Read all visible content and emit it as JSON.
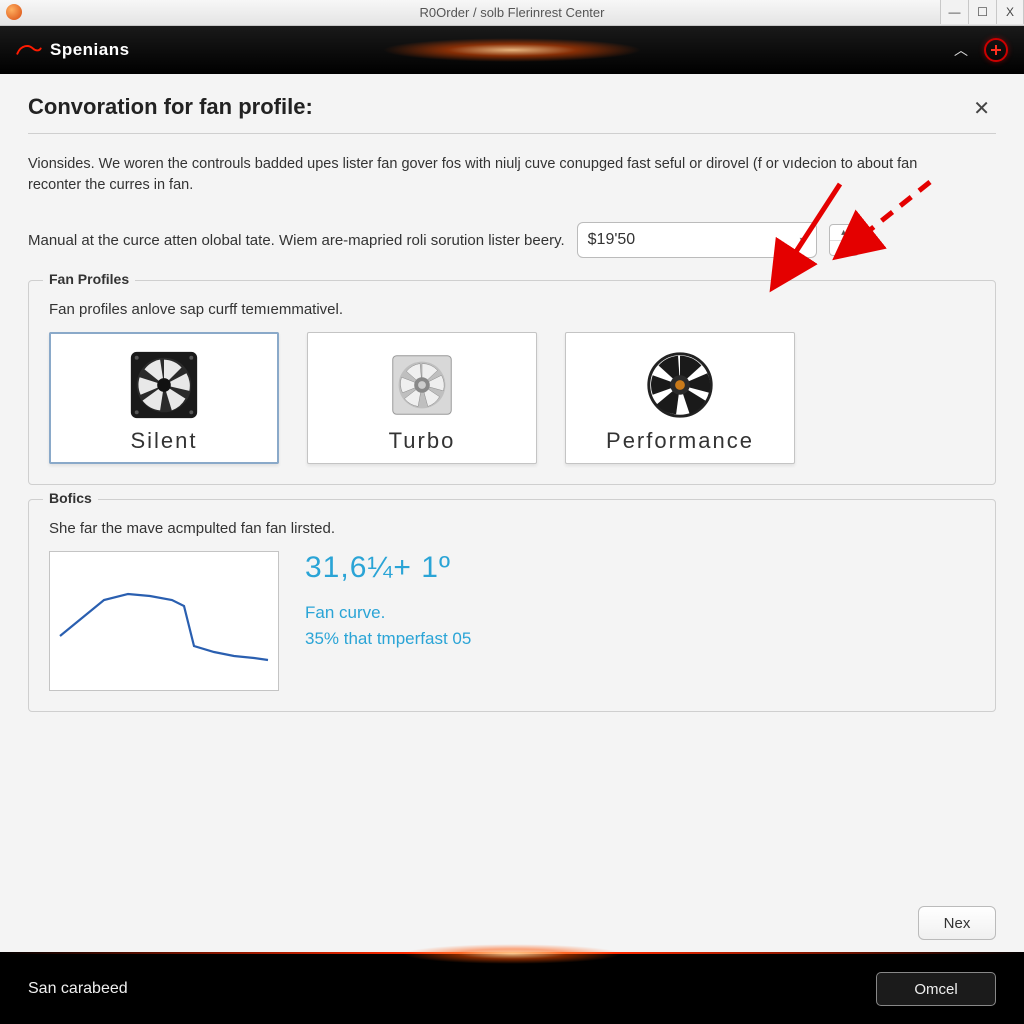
{
  "os": {
    "title": "R0Order / solb Flerinrest Center",
    "min": "—",
    "max": "☐",
    "close": "X"
  },
  "brand": {
    "name": "Spenians"
  },
  "page": {
    "title": "Convoration for fan profile:",
    "description": "Vionsides. We woren the controuls badded upes lister fan gover fos with niulj cuve conupged fast seful or dirovel (f or vıdecion to about fan reconter the curres in fan.",
    "manual_label": "Manual at the curce atten olobal tate. Wiem are-maрried roli sorution lister beery.",
    "dropdown_value": "$19'50"
  },
  "fan_profiles": {
    "legend": "Fan Profiles",
    "sub": "Fan profiles anlove sap curff temıemmativel.",
    "cards": [
      {
        "label": "Silent"
      },
      {
        "label": "Turbo"
      },
      {
        "label": "Performance"
      }
    ]
  },
  "bofics": {
    "legend": "Bofics",
    "sub": "She far the mave acmpulted fan fan lirsted.",
    "metric_big": "31,6¼+ 1º",
    "line1": "Fan curve.",
    "line2": "35% that tmperfast 05"
  },
  "buttons": {
    "next": "Nex",
    "cancel": "Omcel"
  },
  "footer": {
    "status": "San carabeed"
  },
  "chart_data": {
    "type": "line",
    "x": [
      0,
      10,
      20,
      30,
      40,
      50,
      55,
      60,
      70,
      80,
      90,
      100
    ],
    "y": [
      42,
      55,
      65,
      68,
      66,
      64,
      60,
      35,
      30,
      28,
      27,
      26
    ],
    "xlim": [
      0,
      100
    ],
    "ylim": [
      0,
      100
    ],
    "title": "",
    "xlabel": "",
    "ylabel": ""
  }
}
